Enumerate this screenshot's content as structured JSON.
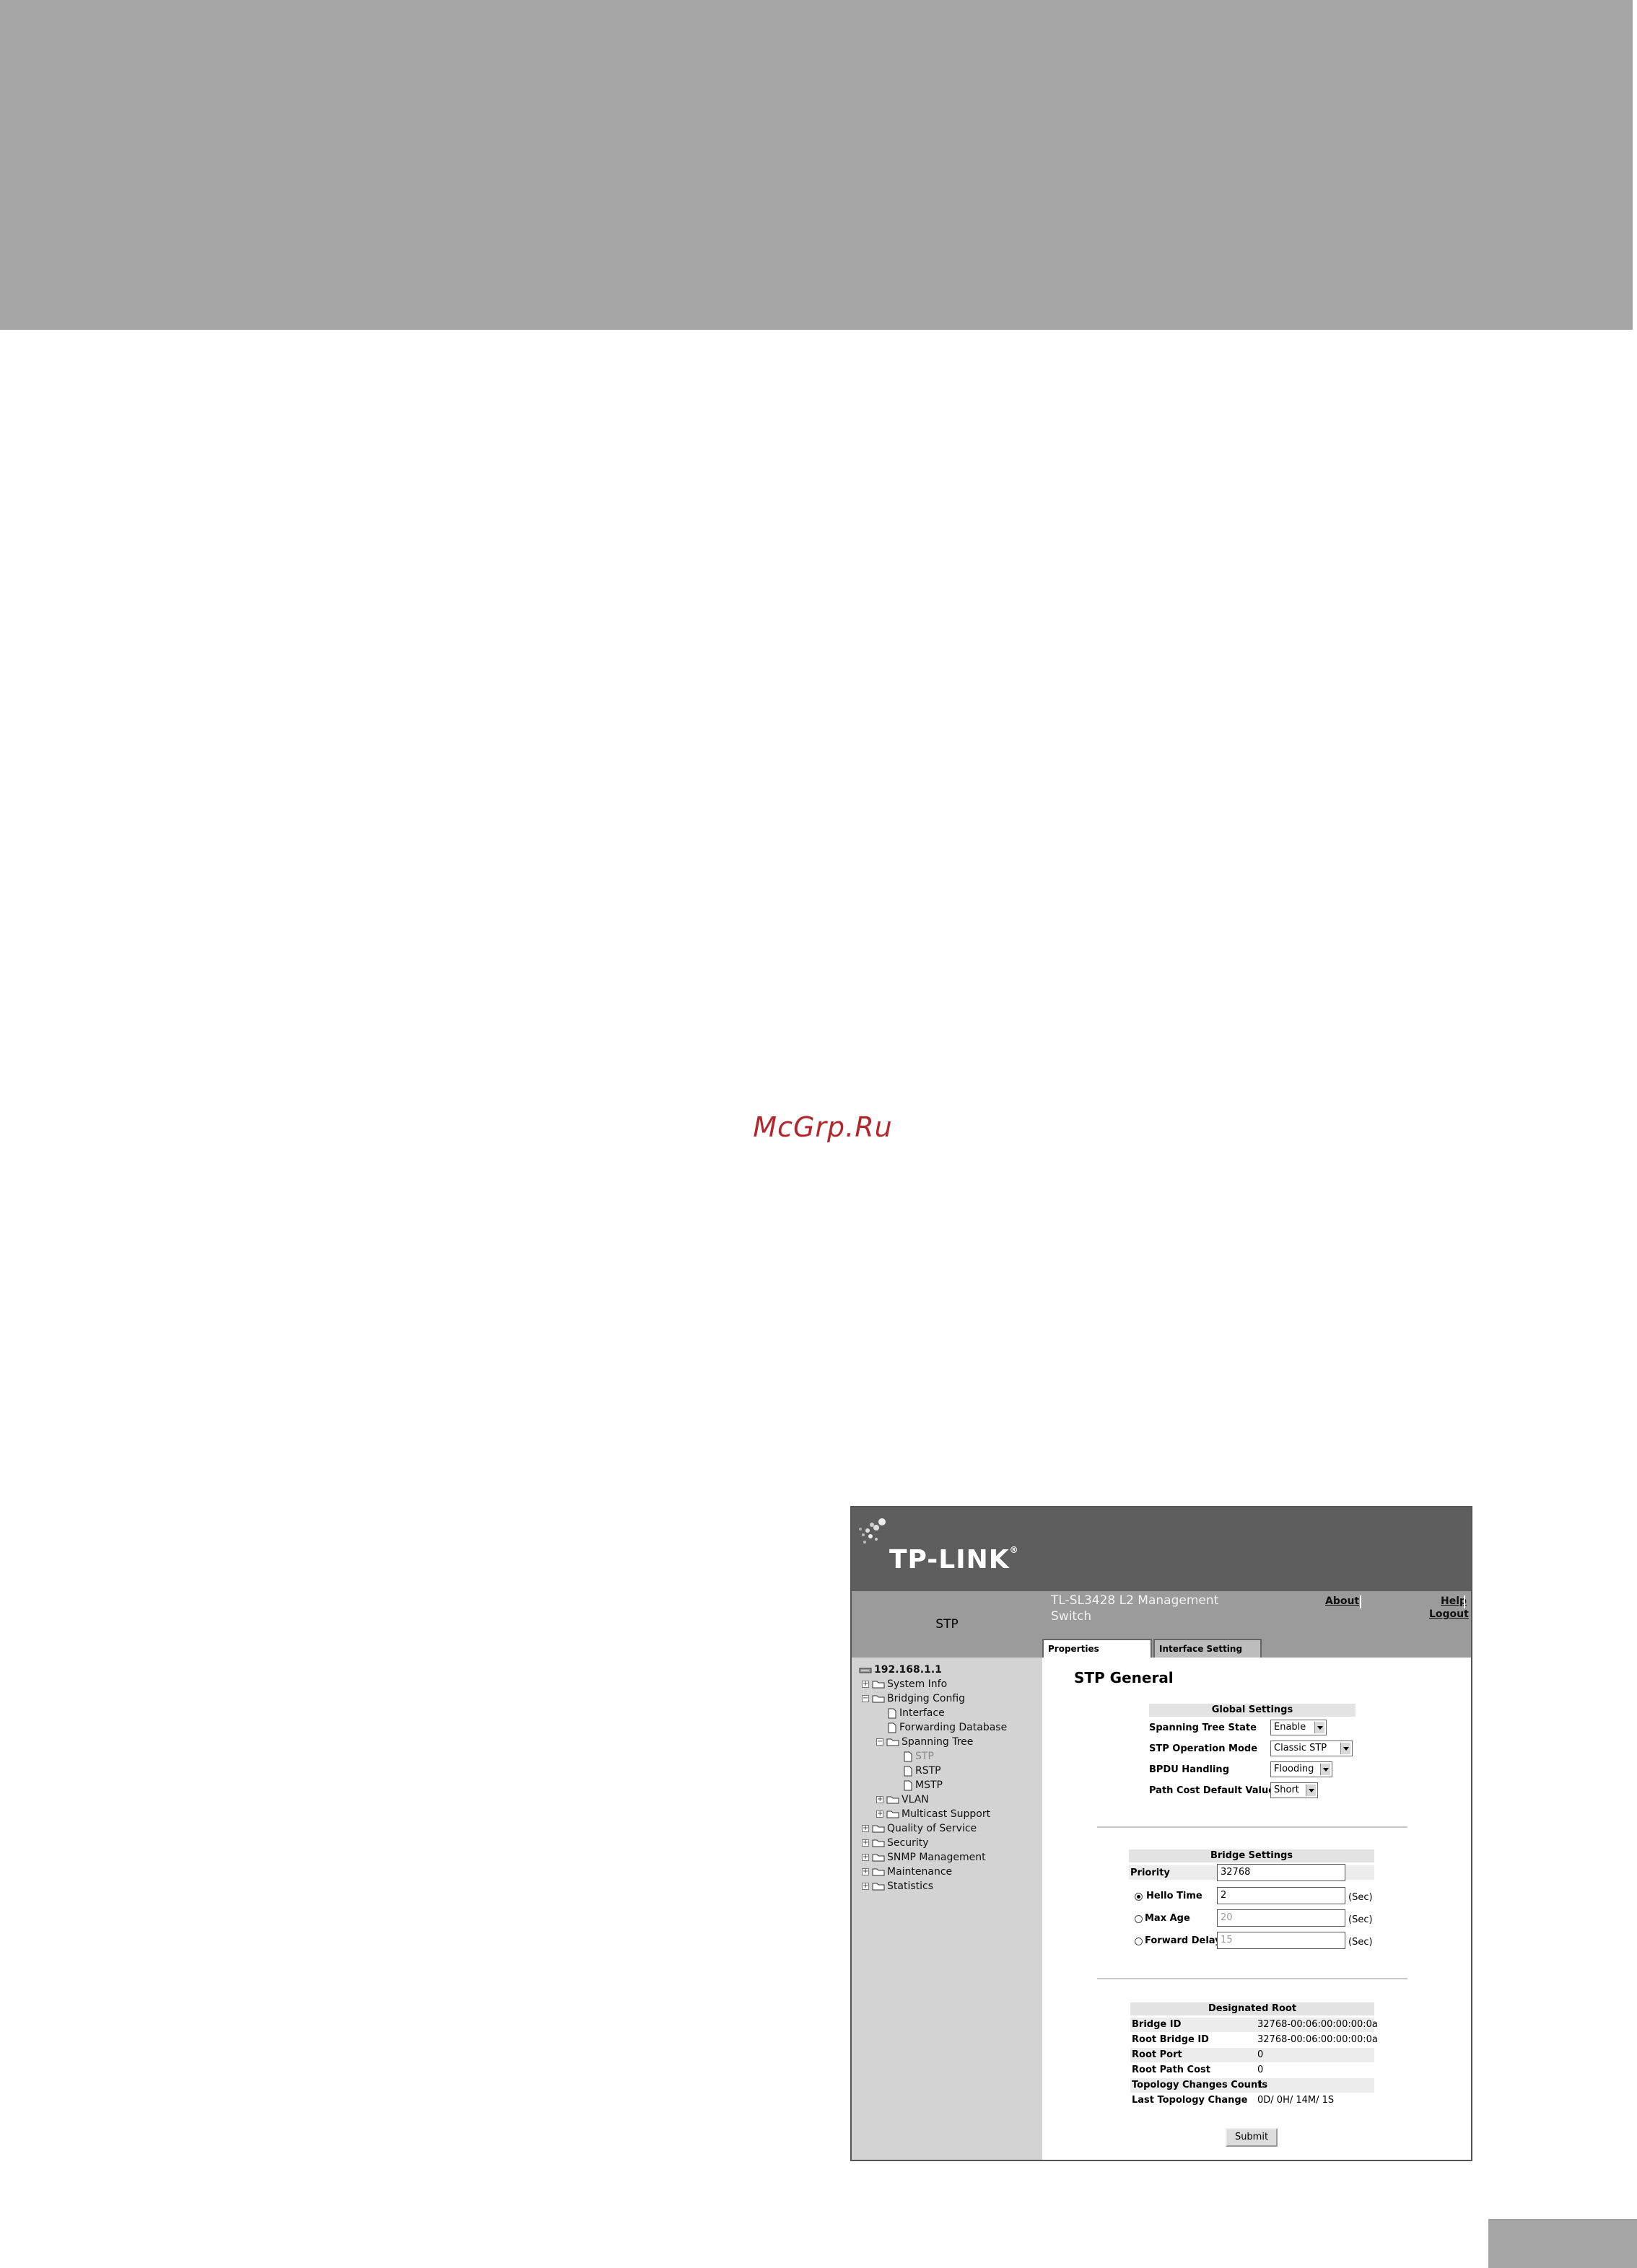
{
  "watermark": "McGrp.Ru",
  "app": {
    "logo": "TP-LINK",
    "logo_mark": "®",
    "nav_title": "STP",
    "product_name": "TL-SL3428 L2 Management Switch",
    "links": {
      "about": "About",
      "help": "Help",
      "logout": "Logout"
    }
  },
  "tabs": [
    {
      "label": "Properties",
      "active": true
    },
    {
      "label": "Interface Setting",
      "active": false
    }
  ],
  "tree": [
    {
      "label": "192.168.1.1",
      "type": "root"
    },
    {
      "label": "System Info",
      "type": "folder",
      "expander": "+"
    },
    {
      "label": "Bridging Config",
      "type": "folder",
      "expander": "-"
    },
    {
      "label": "Interface",
      "type": "page"
    },
    {
      "label": "Forwarding Database",
      "type": "page"
    },
    {
      "label": "Spanning Tree",
      "type": "folder",
      "expander": "-"
    },
    {
      "label": "STP",
      "type": "page",
      "selected": true
    },
    {
      "label": "RSTP",
      "type": "page"
    },
    {
      "label": "MSTP",
      "type": "page"
    },
    {
      "label": "VLAN",
      "type": "folder",
      "expander": "+"
    },
    {
      "label": "Multicast Support",
      "type": "folder",
      "expander": "+"
    },
    {
      "label": "Quality of Service",
      "type": "folder",
      "expander": "+"
    },
    {
      "label": "Security",
      "type": "folder",
      "expander": "+"
    },
    {
      "label": "SNMP Management",
      "type": "folder",
      "expander": "+"
    },
    {
      "label": "Maintenance",
      "type": "folder",
      "expander": "+"
    },
    {
      "label": "Statistics",
      "type": "folder",
      "expander": "+"
    }
  ],
  "page_title": "STP General",
  "global_settings": {
    "title": "Global Settings",
    "rows": [
      {
        "label": "Spanning Tree State",
        "value": "Enable"
      },
      {
        "label": "STP Operation Mode",
        "value": "Classic STP"
      },
      {
        "label": "BPDU Handling",
        "value": "Flooding"
      },
      {
        "label": "Path Cost Default Values",
        "value": "Short"
      }
    ]
  },
  "bridge_settings": {
    "title": "Bridge Settings",
    "priority_label": "Priority",
    "priority_value": "32768",
    "rows": [
      {
        "label": "Hello Time",
        "value": "2",
        "unit": "(Sec)",
        "selected": true,
        "enabled": true
      },
      {
        "label": "Max Age",
        "value": "20",
        "unit": "(Sec)",
        "selected": false,
        "enabled": false
      },
      {
        "label": "Forward Delay",
        "value": "15",
        "unit": "(Sec)",
        "selected": false,
        "enabled": false
      }
    ]
  },
  "designated_root": {
    "title": "Designated Root",
    "rows": [
      {
        "label": "Bridge ID",
        "value": "32768-00:06:00:00:00:0a"
      },
      {
        "label": "Root Bridge ID",
        "value": "32768-00:06:00:00:00:0a"
      },
      {
        "label": "Root Port",
        "value": "0"
      },
      {
        "label": "Root Path Cost",
        "value": "0"
      },
      {
        "label": "Topology Changes Counts",
        "value": "1"
      },
      {
        "label": "Last Topology Change",
        "value": "0D/ 0H/ 14M/ 1S"
      }
    ]
  },
  "submit_label": "Submit",
  "colors": {
    "band": "#a6a5a6",
    "watermark": "#b3262c",
    "header": "#5e5e5e",
    "sidebar": "#d3d3d3"
  }
}
